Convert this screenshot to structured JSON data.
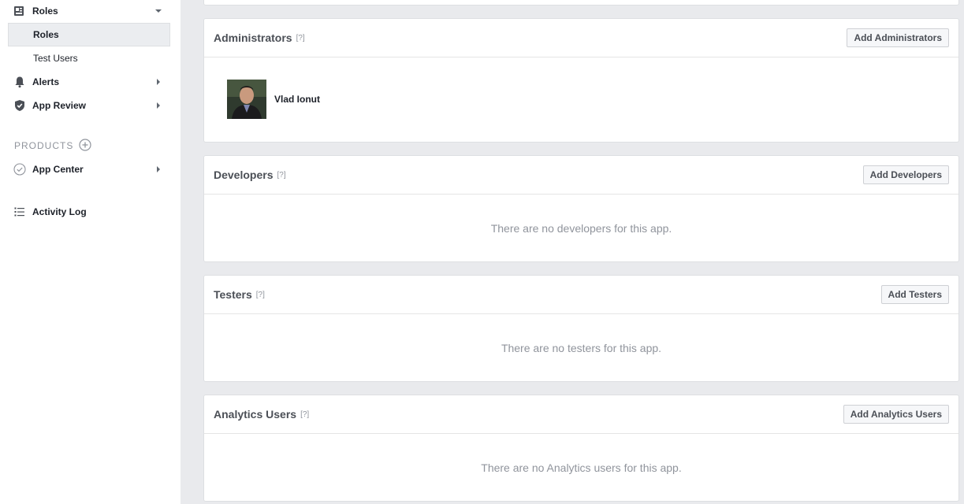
{
  "sidebar": {
    "roles": {
      "label": "Roles",
      "icon": "roles-icon"
    },
    "roles_sub": [
      {
        "label": "Roles",
        "active": true
      },
      {
        "label": "Test Users",
        "active": false
      }
    ],
    "alerts": {
      "label": "Alerts",
      "icon": "bell-icon"
    },
    "app_review": {
      "label": "App Review",
      "icon": "shield-icon"
    },
    "products_label": "PRODUCTS",
    "app_center": {
      "label": "App Center",
      "icon": "check-circle-icon"
    },
    "activity_log": {
      "label": "Activity Log",
      "icon": "list-icon"
    }
  },
  "cards": {
    "administrators": {
      "title": "Administrators",
      "help": "[?]",
      "button": "Add Administrators",
      "members": [
        {
          "name": "Vlad Ionut"
        }
      ]
    },
    "developers": {
      "title": "Developers",
      "help": "[?]",
      "button": "Add Developers",
      "empty": "There are no developers for this app."
    },
    "testers": {
      "title": "Testers",
      "help": "[?]",
      "button": "Add Testers",
      "empty": "There are no testers for this app."
    },
    "analytics": {
      "title": "Analytics Users",
      "help": "[?]",
      "button": "Add Analytics Users",
      "empty": "There are no Analytics users for this app."
    }
  },
  "colors": {
    "background": "#e9eaed",
    "card_border": "#dddfe2",
    "muted_text": "#90949c",
    "title_text": "#4b4f56"
  }
}
